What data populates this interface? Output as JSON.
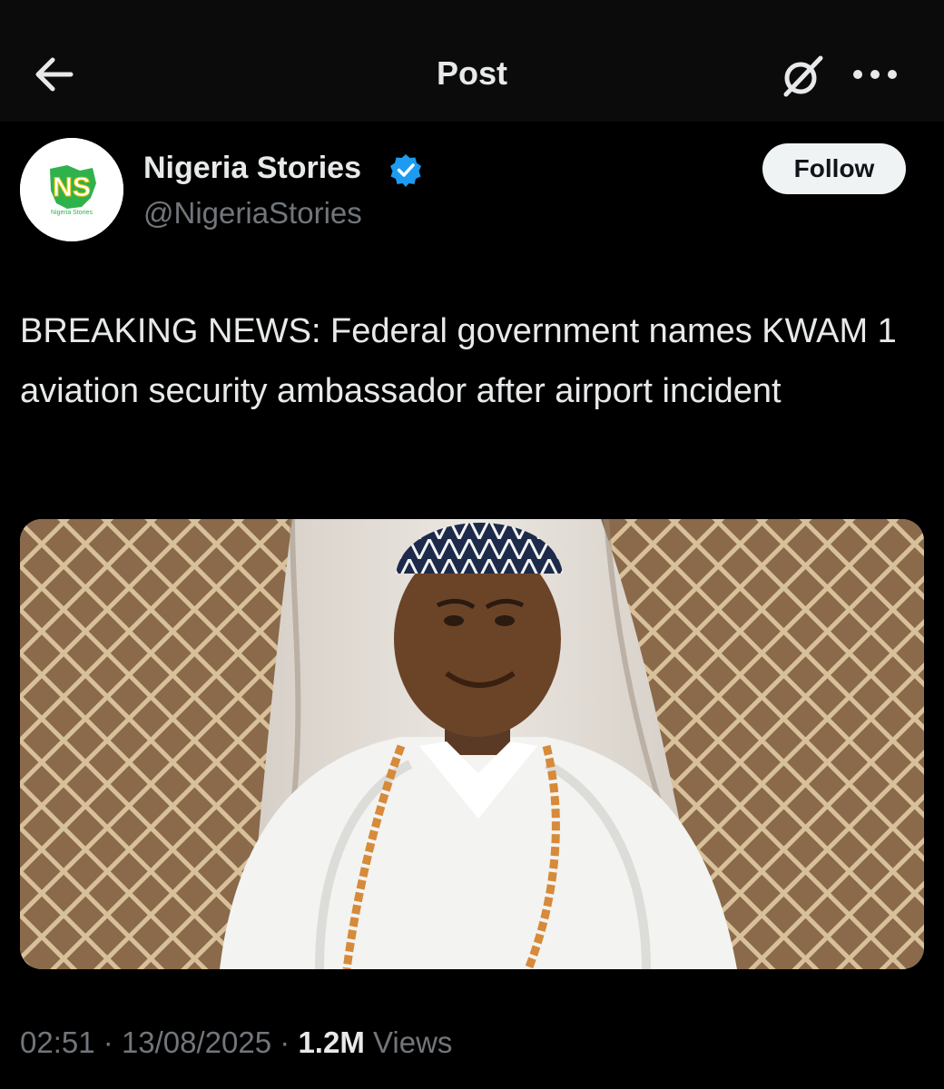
{
  "header": {
    "title": "Post",
    "back_icon": "arrow-left-icon",
    "grok_icon": "grok-icon",
    "more_icon": "more-horizontal-icon"
  },
  "post": {
    "author": {
      "name": "Nigeria Stories",
      "handle": "@NigeriaStories",
      "verified": true,
      "avatar_logo_text": "NS",
      "avatar_sub_text": "Nigeria Stories"
    },
    "follow_label": "Follow",
    "text": "BREAKING NEWS: Federal government names KWAM 1 aviation security ambassador after airport incident",
    "media": {
      "kind": "photo",
      "description_icon": "photo-portrait"
    },
    "meta": {
      "time": "02:51",
      "date": "13/08/2025",
      "separator": "·",
      "views_count": "1.2M",
      "views_label": "Views"
    }
  },
  "colors": {
    "background": "#000000",
    "text": "#e7e9ea",
    "secondary": "#71767b",
    "verified": "#1d9bf0",
    "logo_green": "#2fb24c"
  }
}
